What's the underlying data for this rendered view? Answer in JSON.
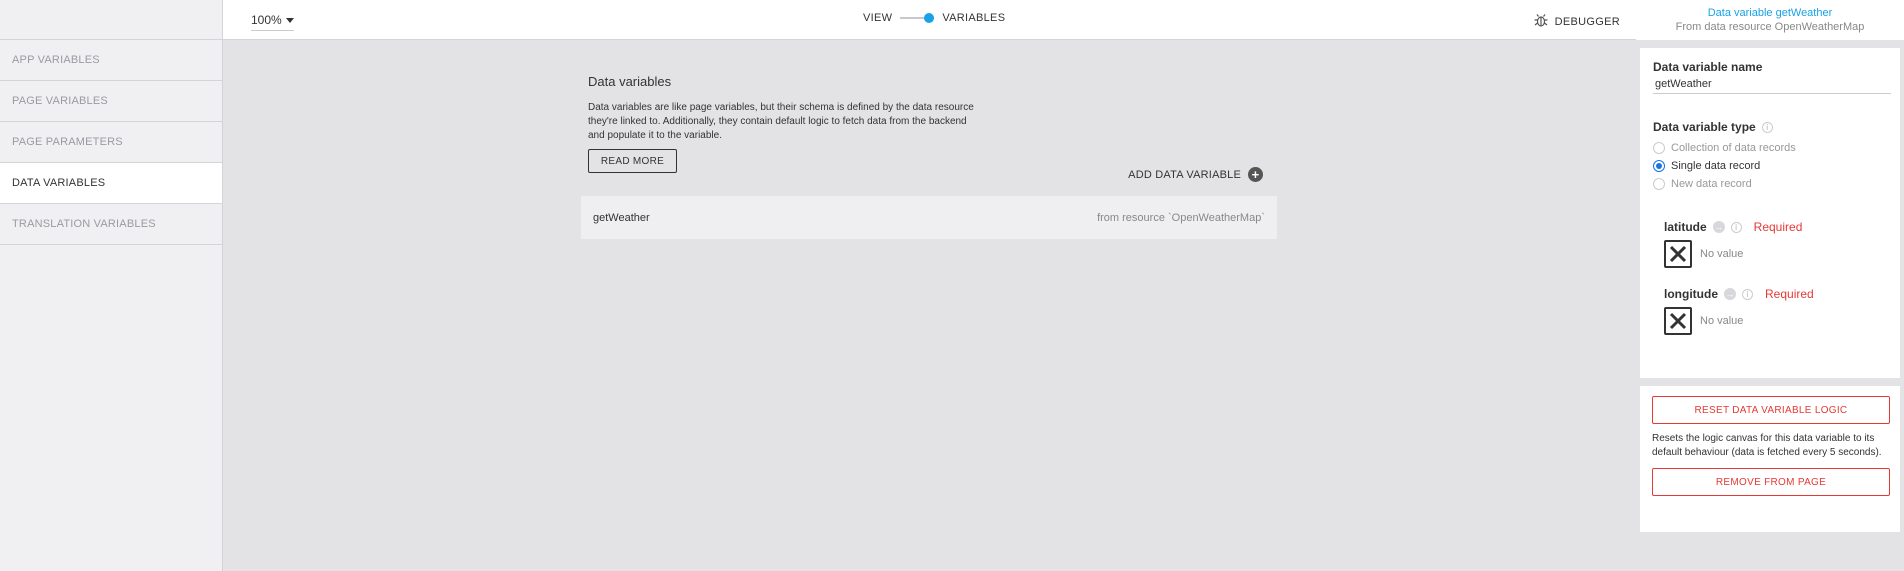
{
  "sidebar": {
    "items": [
      {
        "label": "APP VARIABLES"
      },
      {
        "label": "PAGE VARIABLES"
      },
      {
        "label": "PAGE PARAMETERS"
      },
      {
        "label": "DATA VARIABLES",
        "active": true
      },
      {
        "label": "TRANSLATION VARIABLES"
      }
    ]
  },
  "topbar": {
    "zoom": "100%",
    "view_label": "VIEW",
    "variables_label": "VARIABLES",
    "debugger_label": "DEBUGGER"
  },
  "main": {
    "title": "Data variables",
    "description": "Data variables are like page variables, but their schema is defined by the data resource they're linked to. Additionally, they contain default logic to fetch data from the backend and populate it to the variable.",
    "read_more": "READ MORE",
    "add_button": "ADD DATA VARIABLE",
    "variables": [
      {
        "name": "getWeather",
        "source": "from resource `OpenWeatherMap`"
      }
    ]
  },
  "panel": {
    "header_link": "Data variable getWeather",
    "header_sub": "From data resource OpenWeatherMap",
    "name_label": "Data variable name",
    "name_value": "getWeather",
    "type_label": "Data variable type",
    "types": [
      {
        "label": "Collection of data records",
        "checked": false
      },
      {
        "label": "Single data record",
        "checked": true
      },
      {
        "label": "New data record",
        "checked": false
      }
    ],
    "params": [
      {
        "name": "latitude",
        "required": "Required",
        "value": "No value"
      },
      {
        "name": "longitude",
        "required": "Required",
        "value": "No value"
      }
    ],
    "reset_button": "RESET DATA VARIABLE LOGIC",
    "reset_description": "Resets the logic canvas for this data variable to its default behaviour (data is fetched every 5 seconds).",
    "remove_button": "REMOVE FROM PAGE"
  },
  "colors": {
    "accent": "#1aa2e6",
    "danger": "#e53935",
    "background": "#e3e3e6"
  }
}
